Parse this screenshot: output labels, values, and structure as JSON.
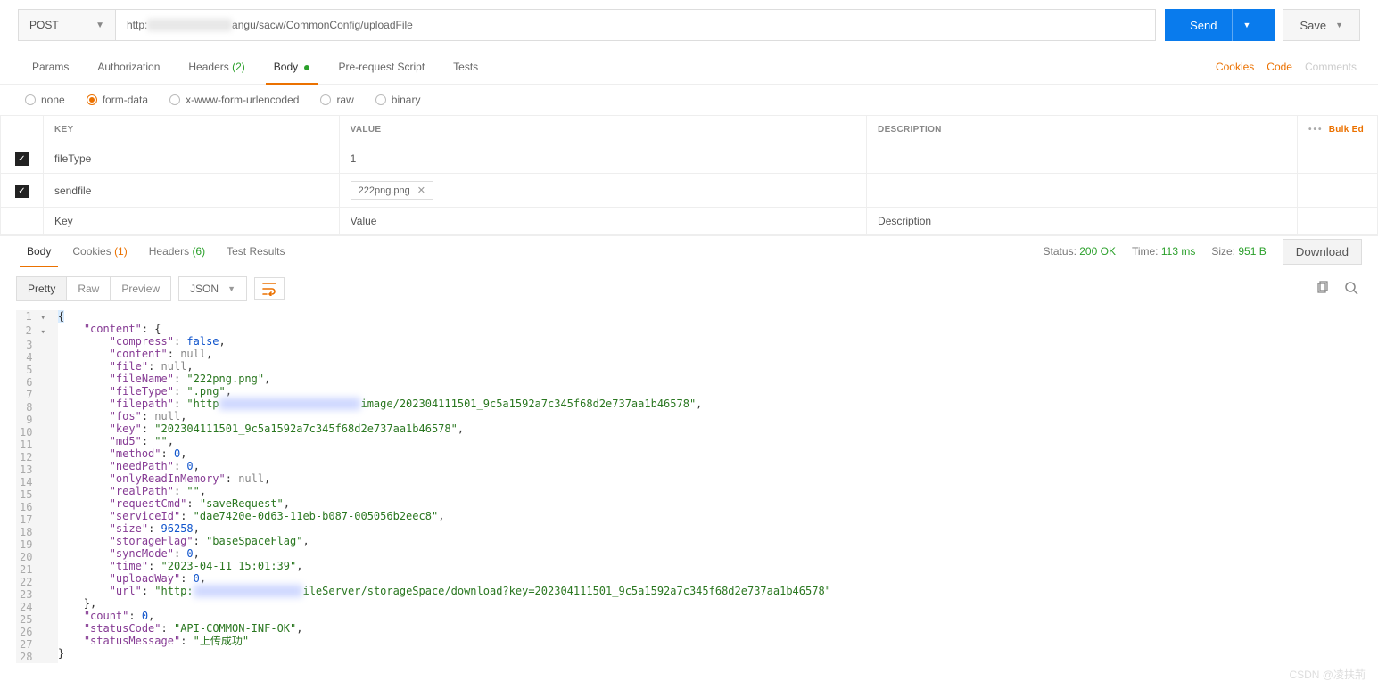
{
  "request": {
    "method": "POST",
    "url_prefix": "http:",
    "url_hidden": "//xx.xx.xxx.xxx/p",
    "url_suffix": "angu/sacw/CommonConfig/uploadFile",
    "send": "Send",
    "save": "Save"
  },
  "tabs": {
    "params": "Params",
    "authorization": "Authorization",
    "headers": "Headers",
    "headers_count": "(2)",
    "body": "Body",
    "prerequest": "Pre-request Script",
    "tests": "Tests"
  },
  "right_links": {
    "cookies": "Cookies",
    "code": "Code",
    "comments": "Comments"
  },
  "body_types": {
    "none": "none",
    "formdata": "form-data",
    "urlencoded": "x-www-form-urlencoded",
    "raw": "raw",
    "binary": "binary"
  },
  "kv": {
    "key_h": "KEY",
    "value_h": "VALUE",
    "desc_h": "DESCRIPTION",
    "bulk": "Bulk Ed",
    "rows": [
      {
        "key": "fileType",
        "value": "1"
      },
      {
        "key": "sendfile",
        "file": "222png.png"
      }
    ],
    "new_key": "Key",
    "new_value": "Value",
    "new_desc": "Description"
  },
  "response": {
    "tabs": {
      "body": "Body",
      "cookies": "Cookies",
      "cookies_count": "(1)",
      "headers": "Headers",
      "headers_count": "(6)",
      "tests": "Test Results"
    },
    "status_l": "Status:",
    "status_v": "200 OK",
    "time_l": "Time:",
    "time_v": "113 ms",
    "size_l": "Size:",
    "size_v": "951 B",
    "download": "Download"
  },
  "view": {
    "pretty": "Pretty",
    "raw": "Raw",
    "preview": "Preview",
    "format": "JSON"
  },
  "json": {
    "content": {
      "compress": "false",
      "content": "null",
      "file": "null",
      "fileName": "\"222png.png\"",
      "fileType": "\".png\"",
      "filepath_prefix": "\"http",
      "filepath_hidden": "://xx.xx.xxx.xxx/xxxx/",
      "filepath_suffix": "image/202304111501_9c5a1592a7c345f68d2e737aa1b46578\"",
      "fos": "null",
      "key": "\"202304111501_9c5a1592a7c345f68d2e737aa1b46578\"",
      "md5": "\"\"",
      "method": "0",
      "needPath": "0",
      "onlyReadInMemory": "null",
      "realPath": "\"\"",
      "requestCmd": "\"saveRequest\"",
      "serviceId": "\"dae7420e-0d63-11eb-b087-005056b2eec8\"",
      "size": "96258",
      "storageFlag": "\"baseSpaceFlag\"",
      "syncMode": "0",
      "time": "\"2023-04-11 15:01:39\"",
      "uploadWay": "0",
      "url_prefix": "\"http:",
      "url_hidden": "//xx.xx.xxx.xxx/f",
      "url_suffix": "ileServer/storageSpace/download?key=202304111501_9c5a1592a7c345f68d2e737aa1b46578\""
    },
    "count": "0",
    "statusCode": "\"API-COMMON-INF-OK\"",
    "statusMessage": "\"上传成功\""
  },
  "watermark": "CSDN @凌扶荊"
}
